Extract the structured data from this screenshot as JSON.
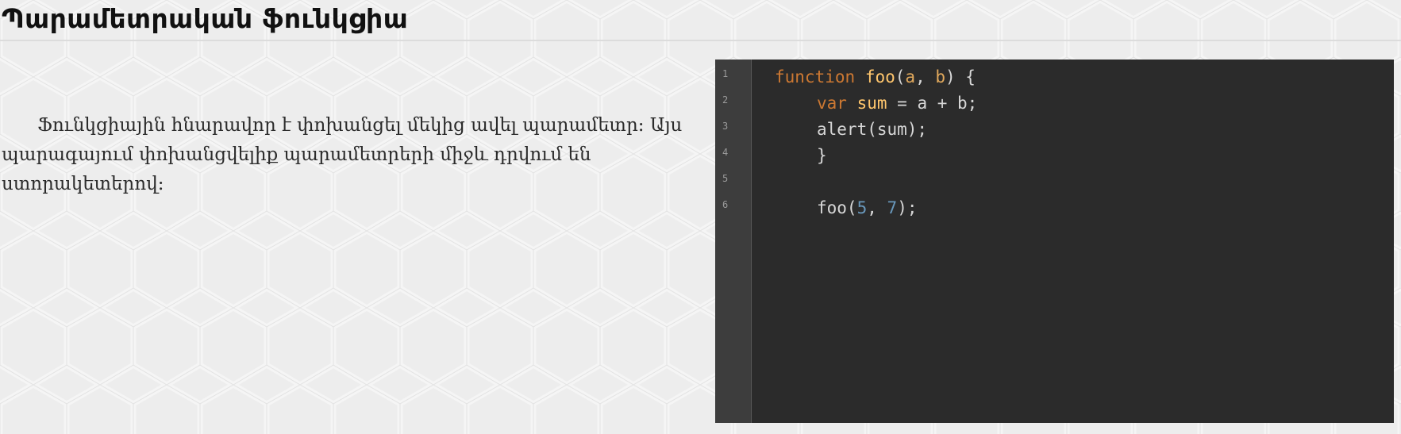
{
  "page": {
    "title": "Պարամետրական ֆունկցիա",
    "description": "Ֆունկցիային հնարավոր է փոխանցել մեկից ավել պարամետր: Այս պարագայում փոխանցվելիք պարամետրերի միջև դրվում են ստորակետերով:"
  },
  "editor": {
    "line_numbers": [
      "1",
      "2",
      "3",
      "4",
      "5",
      "6"
    ],
    "lines": [
      {
        "tokens": [
          {
            "text": "function",
            "type": "keyword"
          },
          {
            "text": " ",
            "type": "plain"
          },
          {
            "text": "foo",
            "type": "function-name"
          },
          {
            "text": "(",
            "type": "plain"
          },
          {
            "text": "a",
            "type": "param"
          },
          {
            "text": ", ",
            "type": "plain"
          },
          {
            "text": "b",
            "type": "param"
          },
          {
            "text": ") {",
            "type": "plain"
          }
        ]
      },
      {
        "tokens": [
          {
            "text": "var",
            "type": "keyword"
          },
          {
            "text": " ",
            "type": "plain"
          },
          {
            "text": "sum",
            "type": "variable"
          },
          {
            "text": " = a + b;",
            "type": "plain"
          }
        ]
      },
      {
        "tokens": [
          {
            "text": "alert(sum);",
            "type": "plain"
          }
        ]
      },
      {
        "tokens": [
          {
            "text": "}",
            "type": "plain"
          }
        ]
      },
      {
        "tokens": []
      },
      {
        "tokens": [
          {
            "text": "foo(",
            "type": "plain"
          },
          {
            "text": "5",
            "type": "number"
          },
          {
            "text": ", ",
            "type": "plain"
          },
          {
            "text": "7",
            "type": "number"
          },
          {
            "text": ");",
            "type": "plain"
          }
        ]
      }
    ]
  },
  "colors": {
    "keyword": "#cc7832",
    "function-name": "#ffc66d",
    "param": "#e0a85c",
    "variable": "#ffc66d",
    "number": "#6897bb",
    "plain": "#d7d7d7",
    "editor_background": "#2b2b2b",
    "gutter_background": "#3d3d3d"
  }
}
